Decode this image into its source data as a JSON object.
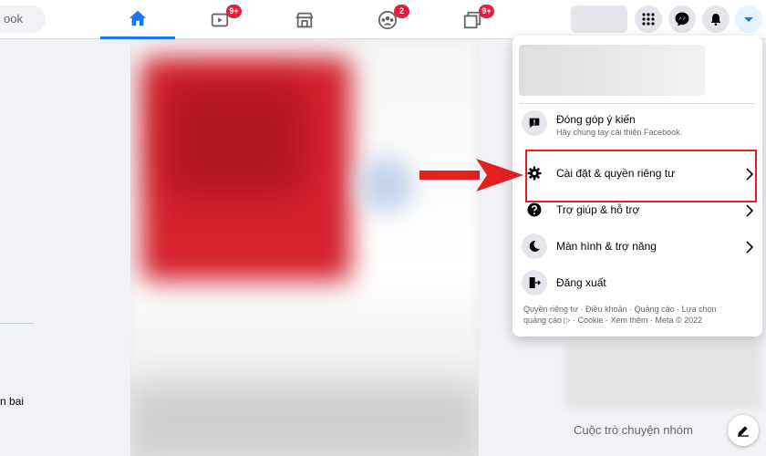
{
  "search": {
    "visible_text": "ook"
  },
  "nav": {
    "tabs": [
      {
        "name": "home",
        "badge": ""
      },
      {
        "name": "watch",
        "badge": "9+"
      },
      {
        "name": "marketplace",
        "badge": ""
      },
      {
        "name": "groups",
        "badge": "2"
      },
      {
        "name": "gaming",
        "badge": "9+"
      }
    ],
    "active_color": "#1877f2",
    "badge_color": "#e41e3f"
  },
  "left": {
    "partial_label": "n bai"
  },
  "menu": {
    "items": [
      {
        "icon": "feedback-icon",
        "label": "Đóng góp ý kiến",
        "sub": "Hãy chung tay cải thiện Facebook."
      },
      {
        "icon": "gear-icon",
        "label": "Cài đặt & quyền riêng tư",
        "chevron": true
      },
      {
        "icon": "help-icon",
        "label": "Trợ giúp & hỗ trợ",
        "chevron": true
      },
      {
        "icon": "moon-icon",
        "label": "Màn hình & trợ năng",
        "chevron": true
      },
      {
        "icon": "logout-icon",
        "label": "Đăng xuất"
      }
    ],
    "footer_line1": "Quyền riêng tư · Điều khoản · Quảng cáo · Lựa chọn",
    "footer_line2": "quảng cáo ▷ · Cookie · Xem thêm · Meta © 2022"
  },
  "right": {
    "group_chats_title": "Cuộc trò chuyện nhóm"
  },
  "annotation": {
    "highlight_color": "#e1201f"
  }
}
